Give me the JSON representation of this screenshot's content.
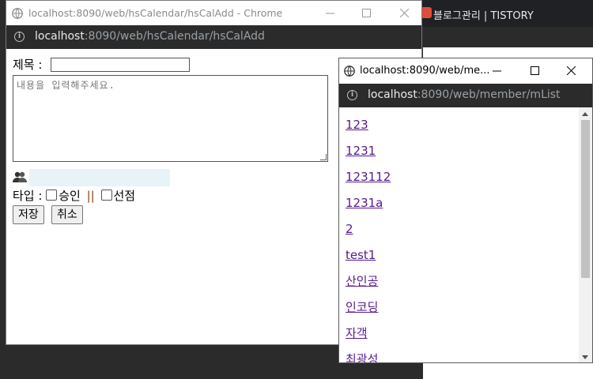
{
  "background_tab": {
    "label": "블로그관리 | TISTORY"
  },
  "main_window": {
    "title": "localhost:8090/web/hsCalendar/hsCalAdd - Chrome",
    "url_host": "localhost",
    "url_rest": ":8090/web/hsCalendar/hsCalAdd",
    "form": {
      "title_label": "제목 :",
      "content_placeholder": "내용을 입력해주세요.",
      "type_label": "타입 :",
      "option_approve": "승인",
      "separator": "||",
      "option_pick": "선점",
      "save_label": "저장",
      "cancel_label": "취소"
    }
  },
  "popup_window": {
    "title": "localhost:8090/web/me...",
    "url_host": "localhost",
    "url_rest": ":8090/web/member/mList",
    "members": [
      "123",
      "1231",
      "123112",
      "1231a",
      "2",
      "test1",
      "산인공",
      "인코딩",
      "자객",
      "최광성"
    ]
  },
  "colors": {
    "link": "#1a0dab",
    "visited": "#551a8b",
    "addressbar": "#2b2b2b"
  }
}
